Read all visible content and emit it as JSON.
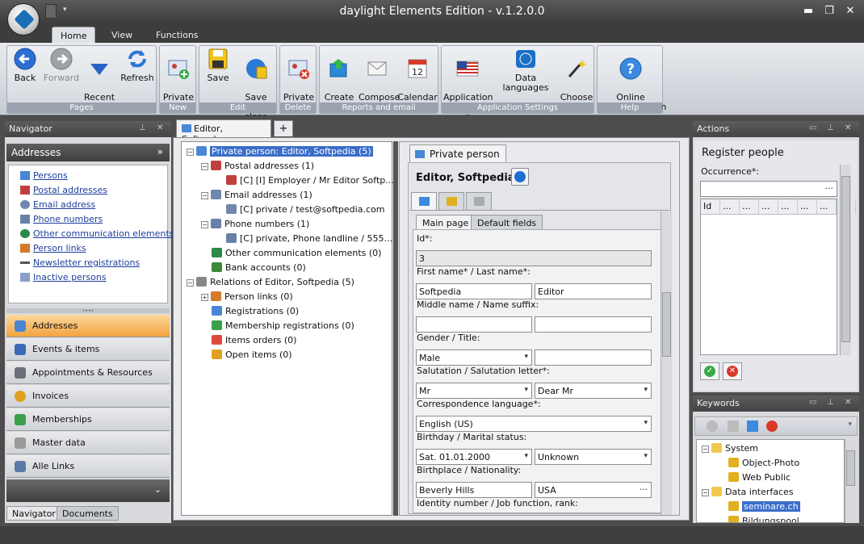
{
  "window": {
    "title": "daylight Elements Edition - v.1.2.0.0"
  },
  "ribbon": {
    "tabs": [
      "Home",
      "View",
      "Functions"
    ],
    "groups": {
      "pages": {
        "label": "Pages",
        "back": "Back",
        "forward": "Forward",
        "recent": "Recent\npages",
        "refresh": "Refresh"
      },
      "new": {
        "label": "New",
        "private_person": "Private\nperson"
      },
      "edit": {
        "label": "Edit",
        "save": "Save",
        "save_close": "Save and\nclose"
      },
      "delete": {
        "label": "Delete",
        "private_person": "Private\nperson"
      },
      "reports": {
        "label": "Reports and email",
        "create_report": "Create\nReport",
        "compose_email": "Compose\nemail",
        "calendar_view": "Calendar\nview"
      },
      "settings": {
        "label": "Application Settings",
        "app_language": "Application\nlanguage",
        "data_languages": "Data languages",
        "choose_skin": "Choose\nskin"
      },
      "help": {
        "label": "Help",
        "online_doc": "Online\ndocumentation"
      }
    }
  },
  "navigator": {
    "title": "Navigator",
    "section": "Addresses",
    "links": [
      "Persons",
      "Postal addresses",
      "Email address",
      "Phone numbers",
      "Other communication elements",
      "Person links",
      "Newsletter registrations",
      "Inactive persons"
    ],
    "buttons": [
      "Addresses",
      "Events & items",
      "Appointments & Resources",
      "Invoices",
      "Memberships",
      "Master data",
      "Alle Links"
    ],
    "bottom_tabs": [
      "Navigator",
      "Documents"
    ]
  },
  "document_tab": {
    "label": "Editor, Softped...",
    "add": "+"
  },
  "tree": [
    {
      "label": "Private person: Editor, Softpedia (5)",
      "level": 0,
      "selected": true,
      "exp": "−",
      "color": "#4a86d4"
    },
    {
      "label": "Postal addresses (1)",
      "level": 1,
      "exp": "−",
      "color": "#c04040"
    },
    {
      "label": "[C] [I] Employer / Mr Editor Softp...",
      "level": 2,
      "color": "#c04040"
    },
    {
      "label": "Email addresses (1)",
      "level": 1,
      "exp": "−",
      "color": "#7088b0"
    },
    {
      "label": "[C] private / test@softpedia.com",
      "level": 2,
      "color": "#7088b0"
    },
    {
      "label": "Phone numbers (1)",
      "level": 1,
      "exp": "−",
      "color": "#6a7fa8"
    },
    {
      "label": "[C] private, Phone landline / 555...",
      "level": 2,
      "color": "#6a7fa8"
    },
    {
      "label": "Other communication elements (0)",
      "level": 1,
      "color": "#2a8a4a"
    },
    {
      "label": "Bank accounts (0)",
      "level": 1,
      "color": "#3a8a3a"
    },
    {
      "label": "Relations of Editor, Softpedia (5)",
      "level": 0,
      "exp": "−",
      "color": "#888"
    },
    {
      "label": "Person links (0)",
      "level": 1,
      "exp": "+",
      "color": "#d47a2a"
    },
    {
      "label": "Registrations (0)",
      "level": 1,
      "color": "#4a86d4"
    },
    {
      "label": "Membership registrations (0)",
      "level": 1,
      "color": "#3aa04a"
    },
    {
      "label": "Items orders (0)",
      "level": 1,
      "color": "#e04a3a"
    },
    {
      "label": "Open items (0)",
      "level": 1,
      "color": "#e0a020"
    }
  ],
  "detail": {
    "tab": "Private person",
    "name": "Editor, Softpedia",
    "subtabs": [
      "Main page",
      "Default fields"
    ],
    "fields": {
      "id_label": "Id*:",
      "id": "3",
      "name_label": "First name* / Last name*:",
      "first_name": "Softpedia",
      "last_name": "Editor",
      "middle_label": "Middle name / Name suffix:",
      "middle": "",
      "suffix": "",
      "gender_label": "Gender / Title:",
      "gender": "Male",
      "title": "",
      "salutation_label": "Salutation / Salutation letter*:",
      "salutation": "Mr",
      "salutation_letter": "Dear Mr",
      "corr_label": "Correspondence language*:",
      "corr": "English (US)",
      "birthday_label": "Birthday / Marital status:",
      "birthday": "Sat. 01.01.2000",
      "marital": "Unknown",
      "birthplace_label": "Birthplace / Nationality:",
      "birthplace": "Beverly Hills",
      "nationality": "USA",
      "identity_label": "Identity number / Job function, rank:"
    }
  },
  "actions": {
    "title": "Actions",
    "heading": "Register people",
    "occurrence_label": "Occurrence*:",
    "grid_cols": [
      "Id",
      "...",
      "...",
      "...",
      "...",
      "...",
      "...",
      "..."
    ]
  },
  "keywords": {
    "title": "Keywords",
    "tree": [
      {
        "label": "System",
        "level": 0,
        "exp": "−"
      },
      {
        "label": "Object-Photo",
        "level": 1
      },
      {
        "label": "Web Public",
        "level": 1
      },
      {
        "label": "Data interfaces",
        "level": 0,
        "exp": "−"
      },
      {
        "label": "seminare.ch",
        "level": 1,
        "selected": true
      },
      {
        "label": "Bildungspool",
        "level": 1
      }
    ]
  }
}
